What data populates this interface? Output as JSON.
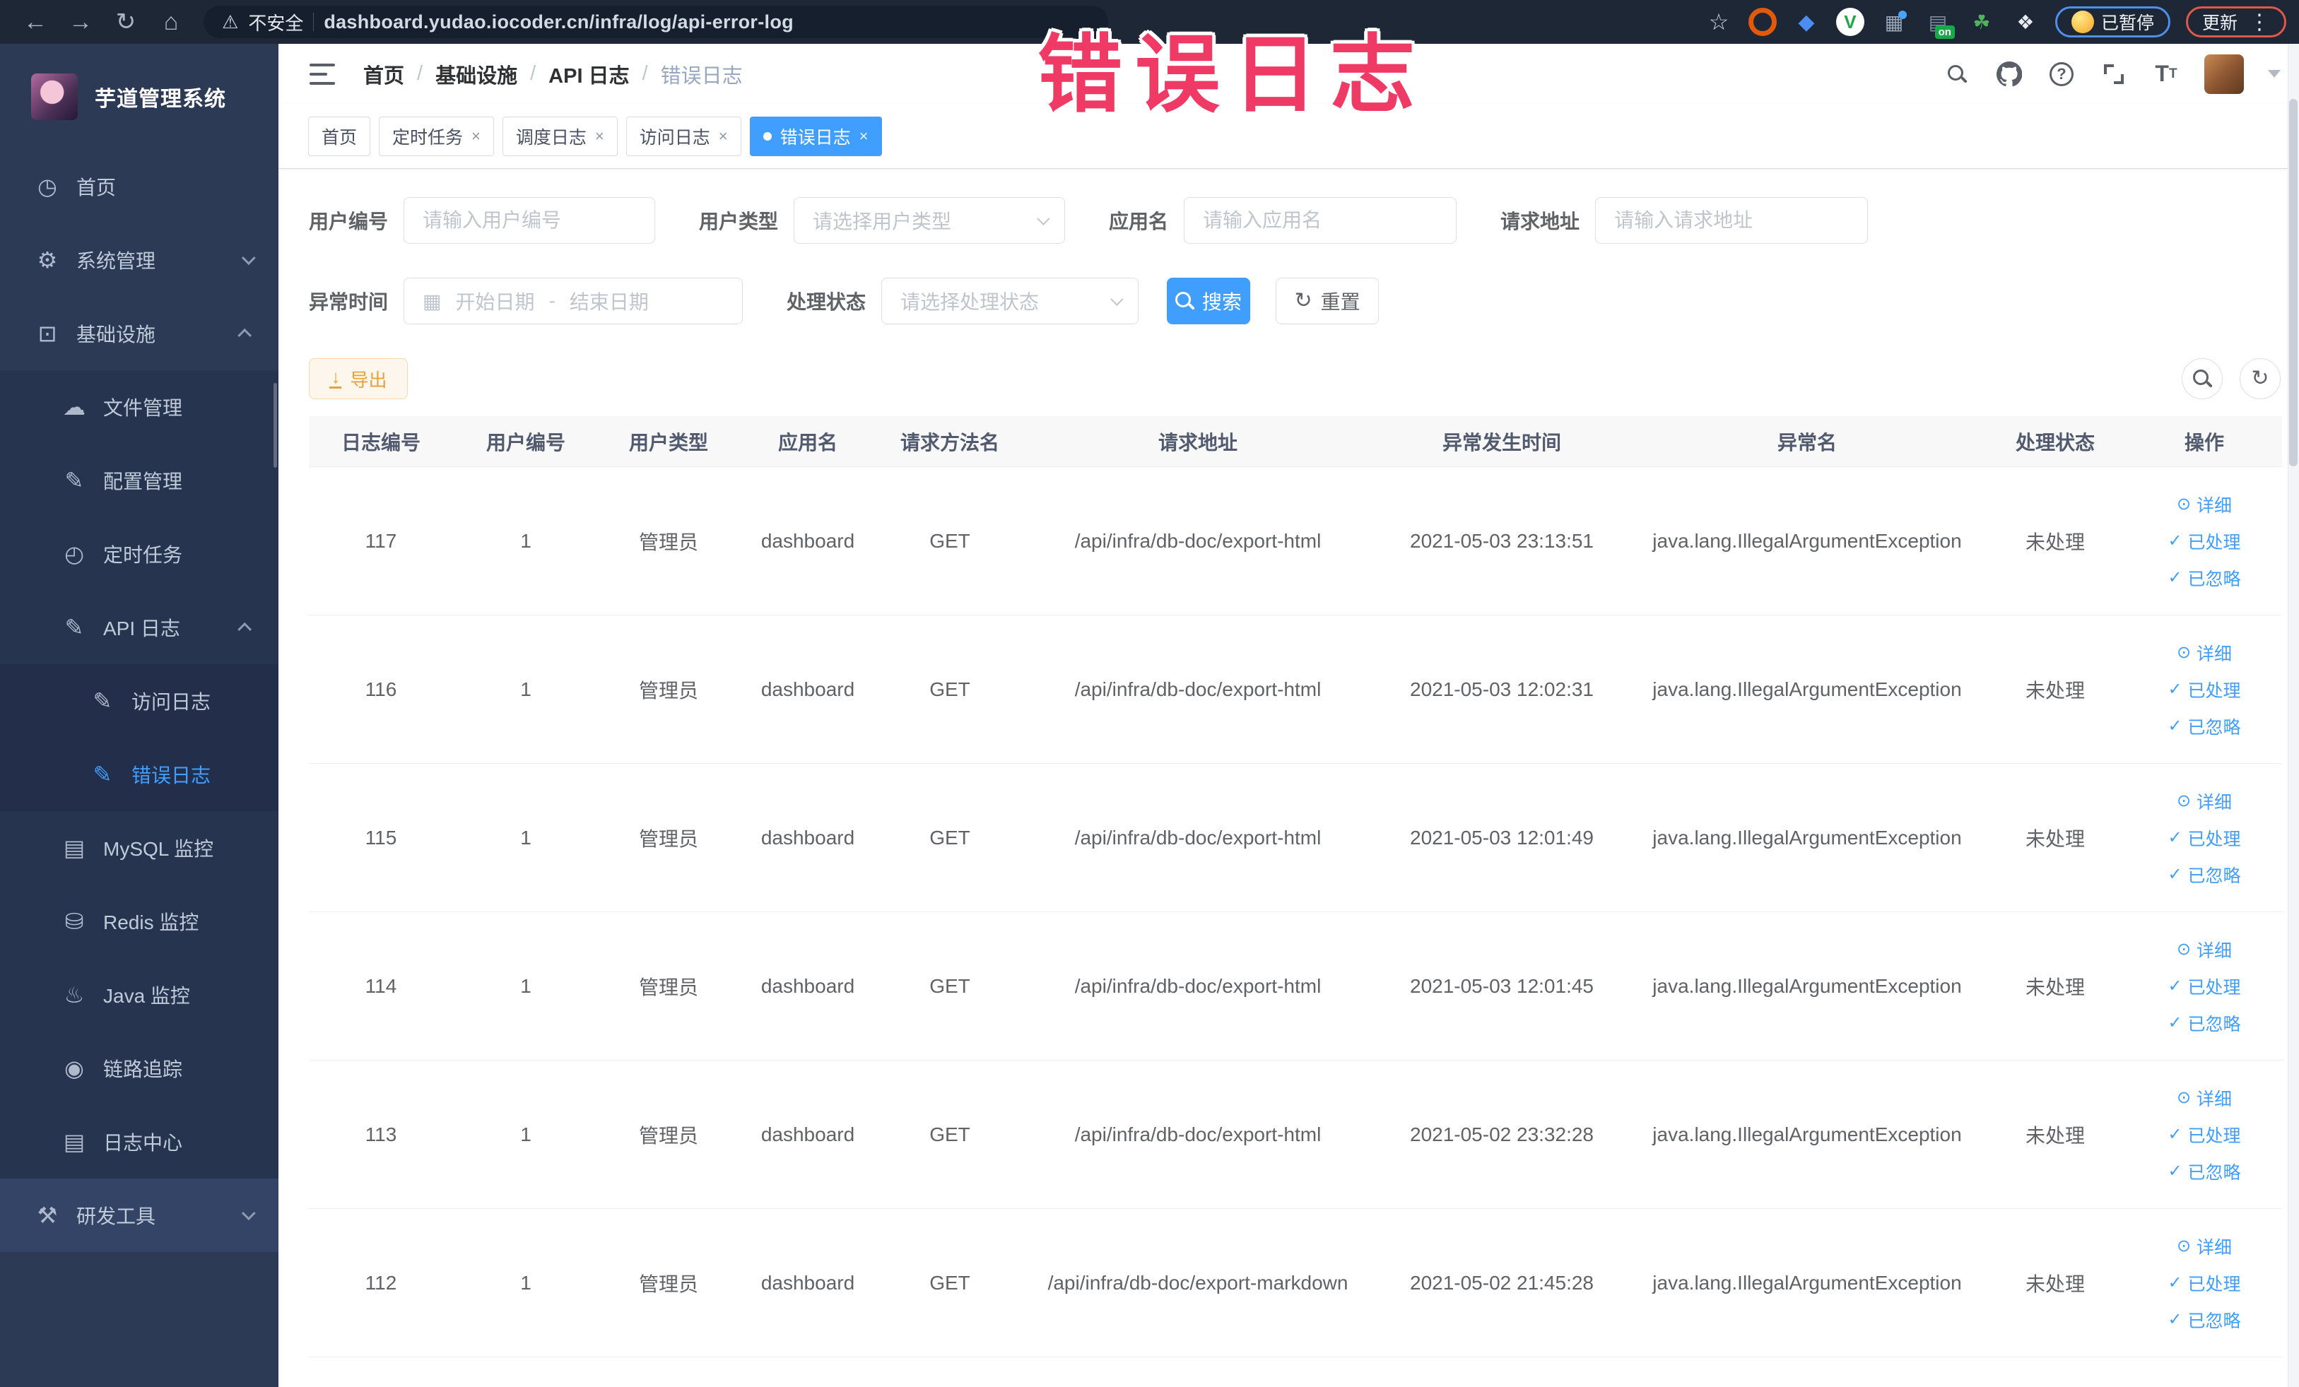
{
  "browser": {
    "security_label": "不安全",
    "url": "dashboard.yudao.iocoder.cn/infra/log/api-error-log",
    "paused_badge": "已暂停",
    "update_badge": "更新"
  },
  "overlay": {
    "title": "错误日志"
  },
  "sidebar": {
    "logo_title": "芋道管理系统",
    "items": [
      {
        "label": "首页",
        "icon": "dashboard-icon",
        "depth": 0
      },
      {
        "label": "系统管理",
        "icon": "gear-icon",
        "depth": 0,
        "arrow": "down"
      },
      {
        "label": "基础设施",
        "icon": "monitor-icon",
        "depth": 0,
        "arrow": "up"
      },
      {
        "label": "文件管理",
        "icon": "upload-cloud-icon",
        "depth": 1
      },
      {
        "label": "配置管理",
        "icon": "edit-icon",
        "depth": 1
      },
      {
        "label": "定时任务",
        "icon": "timer-icon",
        "depth": 1
      },
      {
        "label": "API 日志",
        "icon": "log-icon",
        "depth": 1,
        "arrow": "up"
      },
      {
        "label": "访问日志",
        "icon": "log-icon",
        "depth": 2
      },
      {
        "label": "错误日志",
        "icon": "log-icon",
        "depth": 2,
        "active": true
      },
      {
        "label": "MySQL 监控",
        "icon": "mysql-icon",
        "depth": 1
      },
      {
        "label": "Redis 监控",
        "icon": "redis-icon",
        "depth": 1
      },
      {
        "label": "Java 监控",
        "icon": "java-icon",
        "depth": 1
      },
      {
        "label": "链路追踪",
        "icon": "trace-icon",
        "depth": 1
      },
      {
        "label": "日志中心",
        "icon": "log-center-icon",
        "depth": 1
      },
      {
        "label": "研发工具",
        "icon": "tools-icon",
        "depth": 0,
        "arrow": "down",
        "variant": "light"
      }
    ]
  },
  "header": {
    "breadcrumb": [
      "首页",
      "基础设施",
      "API 日志",
      "错误日志"
    ]
  },
  "tabs": [
    {
      "label": "首页",
      "closable": false,
      "active": false
    },
    {
      "label": "定时任务",
      "closable": true,
      "active": false
    },
    {
      "label": "调度日志",
      "closable": true,
      "active": false
    },
    {
      "label": "访问日志",
      "closable": true,
      "active": false
    },
    {
      "label": "错误日志",
      "closable": true,
      "active": true
    }
  ],
  "filters": {
    "user_id": {
      "label": "用户编号",
      "placeholder": "请输入用户编号"
    },
    "user_type": {
      "label": "用户类型",
      "placeholder": "请选择用户类型"
    },
    "app_name": {
      "label": "应用名",
      "placeholder": "请输入应用名"
    },
    "request_url": {
      "label": "请求地址",
      "placeholder": "请输入请求地址"
    },
    "exception_time": {
      "label": "异常时间",
      "start_placeholder": "开始日期",
      "separator": "-",
      "end_placeholder": "结束日期"
    },
    "process_status": {
      "label": "处理状态",
      "placeholder": "请选择处理状态"
    },
    "search_label": "搜索",
    "reset_label": "重置"
  },
  "toolbar": {
    "export_label": "导出"
  },
  "table": {
    "columns": [
      "日志编号",
      "用户编号",
      "用户类型",
      "应用名",
      "请求方法名",
      "请求地址",
      "异常发生时间",
      "异常名",
      "处理状态",
      "操作"
    ],
    "actions": [
      "详细",
      "已处理",
      "已忽略"
    ],
    "rows": [
      {
        "id": "117",
        "user_id": "1",
        "user_type": "管理员",
        "app": "dashboard",
        "method": "GET",
        "url": "/api/infra/db-doc/export-html",
        "time": "2021-05-03 23:13:51",
        "exception": "java.lang.IllegalArgumentException",
        "status": "未处理"
      },
      {
        "id": "116",
        "user_id": "1",
        "user_type": "管理员",
        "app": "dashboard",
        "method": "GET",
        "url": "/api/infra/db-doc/export-html",
        "time": "2021-05-03 12:02:31",
        "exception": "java.lang.IllegalArgumentException",
        "status": "未处理"
      },
      {
        "id": "115",
        "user_id": "1",
        "user_type": "管理员",
        "app": "dashboard",
        "method": "GET",
        "url": "/api/infra/db-doc/export-html",
        "time": "2021-05-03 12:01:49",
        "exception": "java.lang.IllegalArgumentException",
        "status": "未处理"
      },
      {
        "id": "114",
        "user_id": "1",
        "user_type": "管理员",
        "app": "dashboard",
        "method": "GET",
        "url": "/api/infra/db-doc/export-html",
        "time": "2021-05-03 12:01:45",
        "exception": "java.lang.IllegalArgumentException",
        "status": "未处理"
      },
      {
        "id": "113",
        "user_id": "1",
        "user_type": "管理员",
        "app": "dashboard",
        "method": "GET",
        "url": "/api/infra/db-doc/export-html",
        "time": "2021-05-02 23:32:28",
        "exception": "java.lang.IllegalArgumentException",
        "status": "未处理"
      },
      {
        "id": "112",
        "user_id": "1",
        "user_type": "管理员",
        "app": "dashboard",
        "method": "GET",
        "url": "/api/infra/db-doc/export-markdown",
        "time": "2021-05-02 21:45:28",
        "exception": "java.lang.IllegalArgumentException",
        "status": "未处理"
      }
    ]
  },
  "colors": {
    "accent": "#409eff",
    "active_tab": "#409eff",
    "warning": "#e6a23c",
    "sidebar_bg": "#2d3a56",
    "browser_bar_bg": "#1d2736",
    "overlay_text": "#ee3a64"
  }
}
